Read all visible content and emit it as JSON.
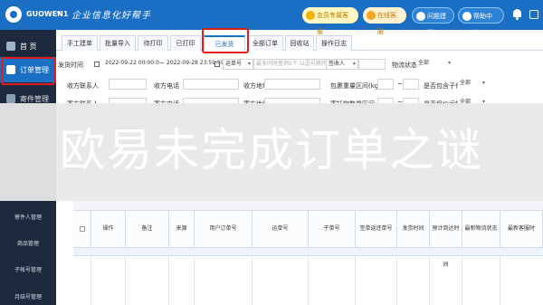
{
  "header": {
    "brand": "GUOWEN1",
    "caret": "▾",
    "slogan": "企业信息化好帮手",
    "vip_label": "会员专属客服",
    "online_label": "在线客服",
    "feedback_label": "问题建议",
    "help_label": "帮助中心 ▾"
  },
  "sidebar": {
    "home": "首 页",
    "orders": "订单管理",
    "reserve": "寄件管理",
    "subs": [
      "寄件人管理",
      "商品管理",
      "子帐号管理",
      "月结号管理"
    ]
  },
  "tabs": [
    "手工建单",
    "批量导入",
    "待打印",
    "已打印",
    "已发货",
    "全部订单",
    "回收站",
    "操作日志"
  ],
  "active_tab": "已发货",
  "filters": {
    "row1": {
      "send_time_label": "发货时间",
      "date_from": "2022-09-22 00:00:00",
      "sep": "~",
      "date_to": "2022-09-28 23:59:59",
      "waybill_select": "运单号",
      "waybill_placeholder": "最多同时查询5个,以逗号隔开",
      "sign_select": "签收人",
      "logistics_label": "物流状态",
      "logistics_value": "全部"
    },
    "row2": {
      "receiver_label": "收方联系人",
      "phone_label": "收方电话",
      "address_label": "收方地址",
      "weight_label": "包裹重量区间(kg)",
      "weight_sep": "~",
      "include_label": "是否包含子件",
      "include_value": "全部"
    },
    "row3": {
      "sender_label": "寄方联系人",
      "sender_phone_label": "寄方电话",
      "sender_address_label": "寄方地址",
      "count_label": "寄托物数量区间",
      "count_sep": "~",
      "insured_label": "是否保价运输",
      "insured_value": "全部"
    }
  },
  "overlay_title": "欧易未完成订单之谜",
  "table": {
    "headers": [
      "操作",
      "备注",
      "来源",
      "用户订单号",
      "运单号",
      "子单号",
      "签单返还单号",
      "发货时间",
      "预计到达时间",
      "最新物流状态",
      "最新客服时"
    ]
  }
}
